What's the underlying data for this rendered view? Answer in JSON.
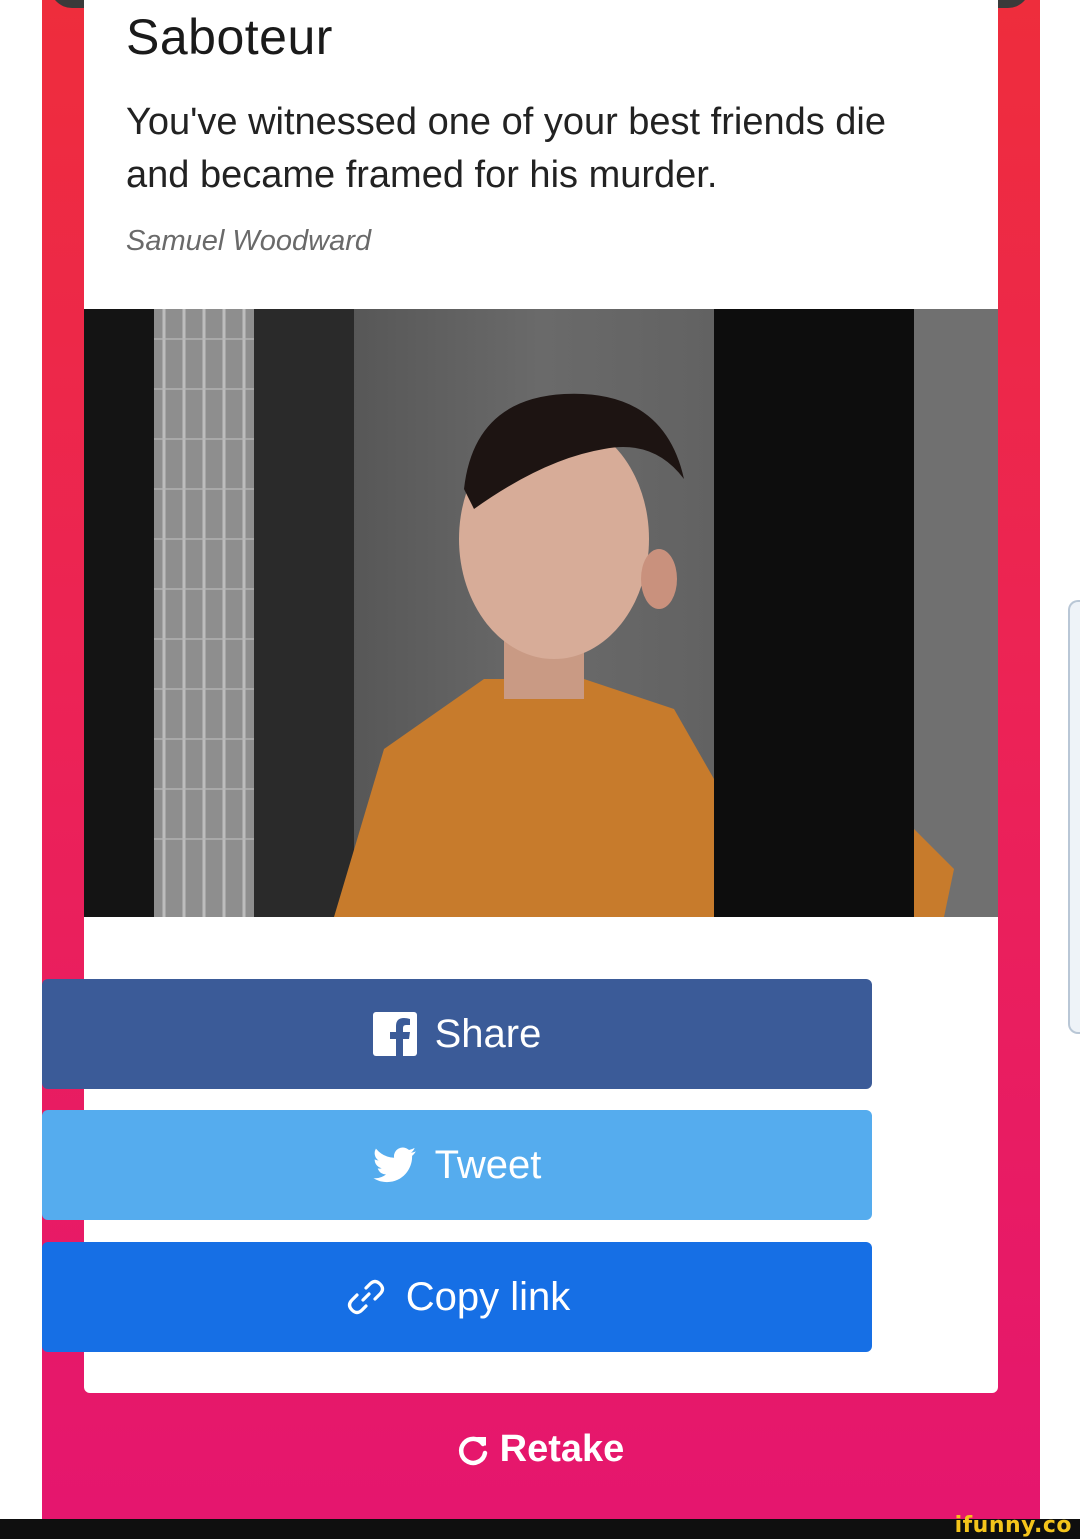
{
  "result": {
    "title": "Saboteur",
    "description": "You've witnessed one of your best friends die and became framed for his murder.",
    "author": "Samuel Woodward"
  },
  "buttons": {
    "share_label": "Share",
    "tweet_label": "Tweet",
    "copy_label": "Copy link"
  },
  "retake_label": "Retake",
  "watermark": "ifunny.co",
  "icons": {
    "share": "facebook-icon",
    "tweet": "twitter-bird-icon",
    "copy": "link-icon",
    "retake": "refresh-icon"
  },
  "colors": {
    "background_top": "#ee2d3c",
    "background_bottom": "#e5166e",
    "share": "#3b5b98",
    "tweet": "#55acee",
    "copy": "#166fe5",
    "watermark": "#f4c41b"
  }
}
